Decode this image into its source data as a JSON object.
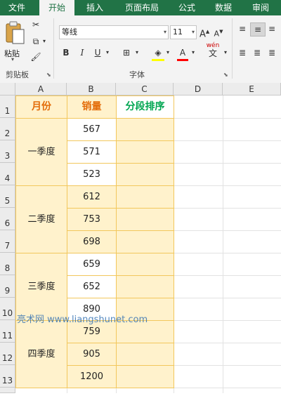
{
  "ribbon_tabs": [
    "文件",
    "开始",
    "插入",
    "页面布局",
    "公式",
    "数据",
    "审阅"
  ],
  "active_tab": "开始",
  "clipboard": {
    "paste_label": "粘贴",
    "group_label": "剪贴板"
  },
  "font": {
    "name": "等线",
    "size": "11",
    "group_label": "字体",
    "bold": "B",
    "italic": "I",
    "underline": "U",
    "grow": "A",
    "shrink": "A",
    "font_color": "A",
    "phonetic": "wén",
    "phonetic_char": "文"
  },
  "columns": [
    "A",
    "B",
    "C",
    "D",
    "E"
  ],
  "rows": [
    "1",
    "2",
    "3",
    "4",
    "5",
    "6",
    "7",
    "8",
    "9",
    "10",
    "11",
    "12",
    "13"
  ],
  "table": {
    "headers": {
      "month": "月份",
      "sales": "销量",
      "rank": "分段排序"
    },
    "quarters": [
      {
        "label": "一季度",
        "values": [
          "567",
          "571",
          "523"
        ]
      },
      {
        "label": "二季度",
        "values": [
          "612",
          "753",
          "698"
        ]
      },
      {
        "label": "三季度",
        "values": [
          "659",
          "652",
          "890"
        ]
      },
      {
        "label": "四季度",
        "values": [
          "759",
          "905",
          "1200"
        ]
      }
    ]
  },
  "watermark": "亮术网 www.liangshunet.com",
  "colors": {
    "ribbon_green": "#217346",
    "header_orange": "#e36c09",
    "header_green": "#00a651",
    "cell_fill": "#fff2cc",
    "cell_border": "#f2c75c"
  }
}
